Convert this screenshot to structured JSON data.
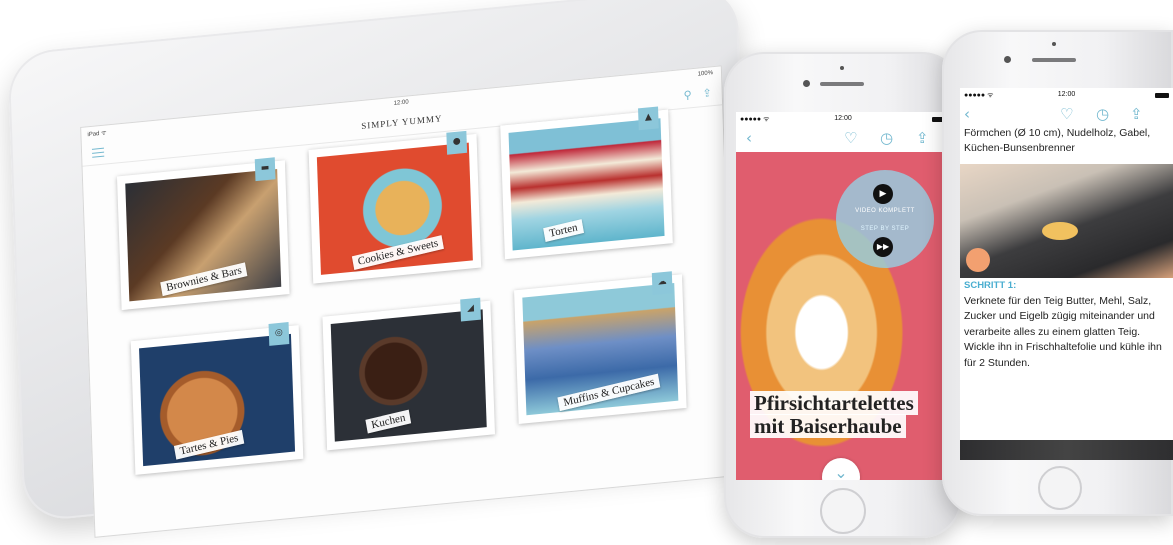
{
  "ipad": {
    "status": {
      "carrier": "iPad ᯤ",
      "time": "12:00",
      "battery": "100%"
    },
    "app_title": "SIMPLY YUMMY",
    "categories": [
      {
        "label": "Brownies & Bars",
        "icon": "brownie-icon"
      },
      {
        "label": "Cookies & Sweets",
        "icon": "cookie-icon"
      },
      {
        "label": "Torten",
        "icon": "cake-icon"
      },
      {
        "label": "Tartes & Pies",
        "icon": "pie-icon"
      },
      {
        "label": "Kuchen",
        "icon": "cake-slice-icon"
      },
      {
        "label": "Muffins & Cupcakes",
        "icon": "cupcake-icon"
      }
    ]
  },
  "phone1": {
    "status": {
      "carrier": "●●●●● ᯤ",
      "time": "12:00"
    },
    "video_full": "VIDEO KOMPLETT",
    "step_by_step": "STEP BY STEP",
    "recipe_title_line1": "Pfirsichtartelettes",
    "recipe_title_line2": "mit Baiserhaube"
  },
  "phone2": {
    "status": {
      "carrier": "●●●●● ᯤ",
      "time": "12:00"
    },
    "ingredients_tail": "Förmchen (Ø 10 cm), Nudelholz, Gabel, Küchen-Bunsenbrenner",
    "step_heading": "SCHRITT 1:",
    "step_text": "Verknete für den Teig Butter, Mehl, Salz, Zucker und Eigelb zügig miteinander und verarbeite alles zu einem glatten Teig. Wickle ihn in Frischhaltefolie und kühle ihn für 2 Stunden."
  },
  "colors": {
    "accent": "#73b8cf",
    "badge": "#8cc7da"
  }
}
